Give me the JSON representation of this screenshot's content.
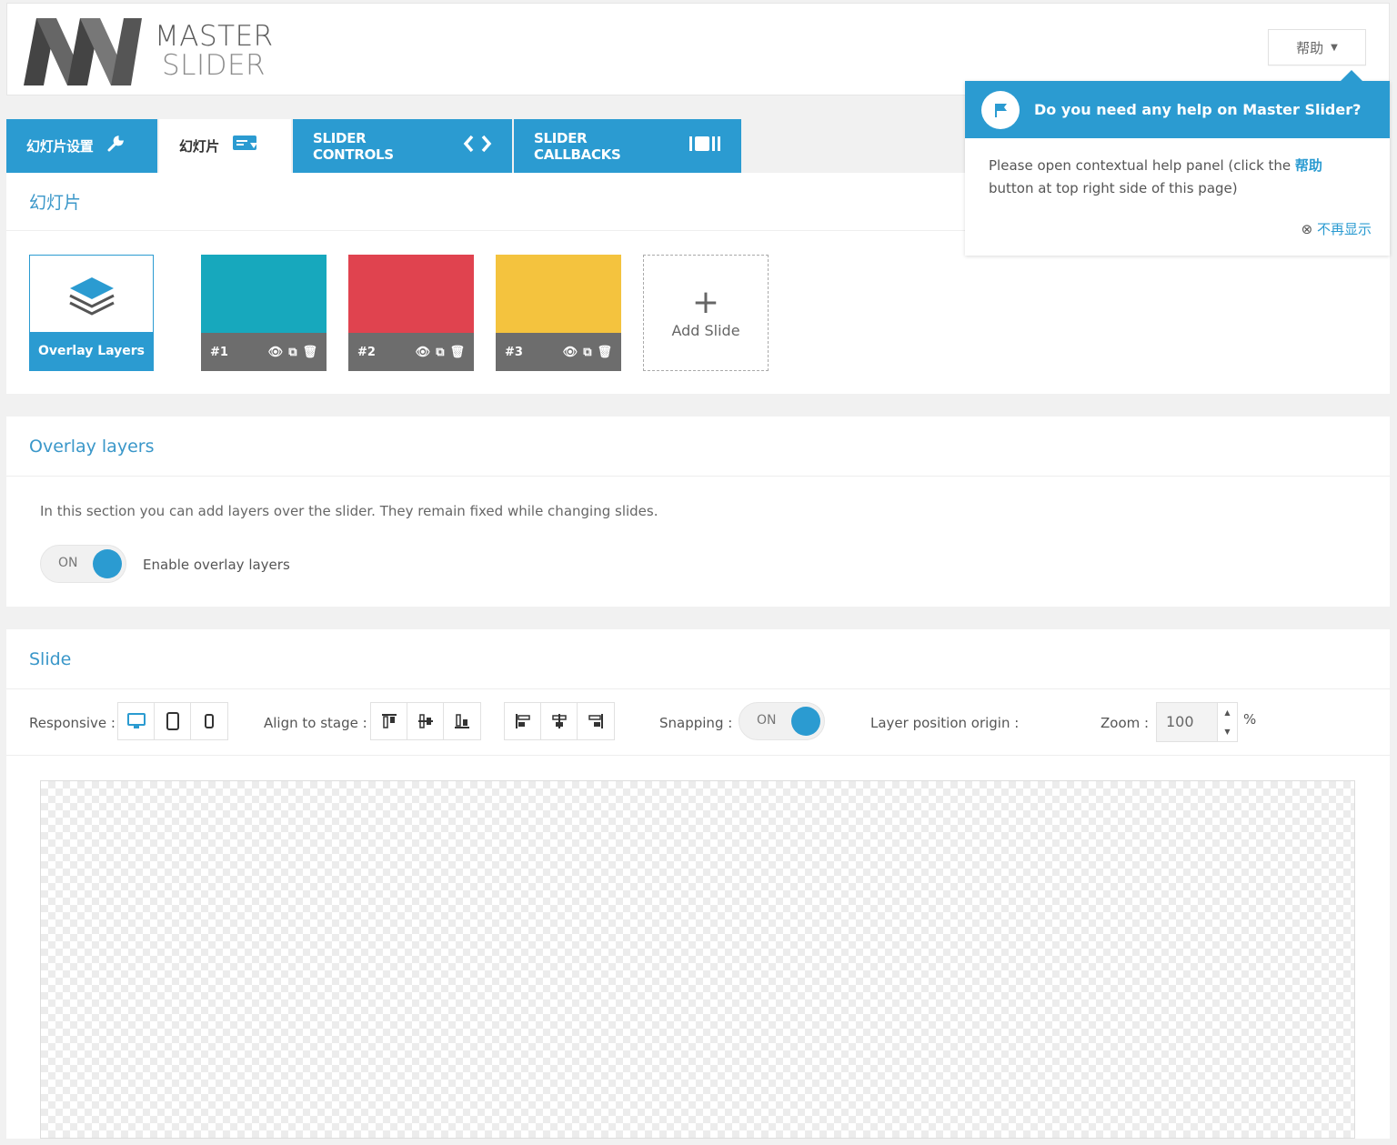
{
  "header": {
    "logo_line1": "MASTER",
    "logo_line2": "SLIDER",
    "help_button": "帮助"
  },
  "tabs": [
    {
      "label": "幻灯片设置",
      "icon": "wrench-icon"
    },
    {
      "label": "幻灯片",
      "icon": "slides-icon",
      "active": true
    },
    {
      "label": "SLIDER CONTROLS",
      "icon": "code-arrows-icon"
    },
    {
      "label": "SLIDER CALLBACKS",
      "icon": "callbacks-icon"
    }
  ],
  "slides_panel": {
    "title": "幻灯片",
    "overlay_card": "Overlay Layers",
    "slides": [
      {
        "label": "#1",
        "color": "#17a8bd"
      },
      {
        "label": "#2",
        "color": "#e0434f"
      },
      {
        "label": "#3",
        "color": "#f4c33e"
      }
    ],
    "add_slide": "Add Slide"
  },
  "overlay_panel": {
    "title": "Overlay layers",
    "description": "In this section you can add layers over the slider. They remain fixed while changing slides.",
    "toggle_text": "ON",
    "toggle_label": "Enable overlay layers"
  },
  "slide_panel": {
    "title": "Slide",
    "responsive_label": "Responsive :",
    "align_label": "Align to stage :",
    "snapping_label": "Snapping :",
    "snapping_toggle": "ON",
    "origin_label": "Layer position origin :",
    "zoom_label": "Zoom :",
    "zoom_value": "100",
    "zoom_unit": "%"
  },
  "help_popover": {
    "title": "Do you need any help on Master Slider?",
    "body_before": "Please open contextual help panel (click the ",
    "body_highlight": "帮助",
    "body_after": " button at top right side of this page)",
    "dismiss": "不再显示"
  },
  "colors": {
    "accent": "#2b9bd1"
  }
}
